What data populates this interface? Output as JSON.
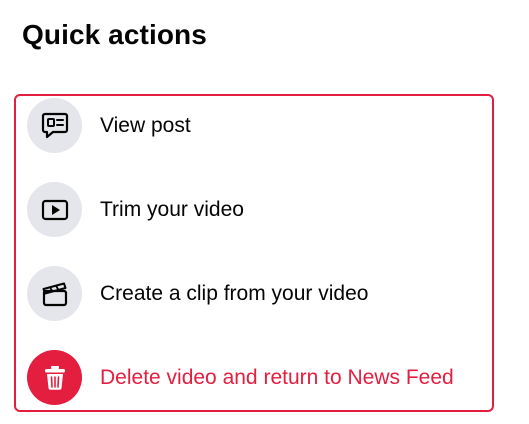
{
  "title": "Quick actions",
  "actions": [
    {
      "label": "View post",
      "icon": "speech-bubble-post-icon"
    },
    {
      "label": "Trim your video",
      "icon": "play-icon"
    },
    {
      "label": "Create a clip from your video",
      "icon": "clapperboard-icon"
    },
    {
      "label": "Delete video and return to News Feed",
      "icon": "trash-icon"
    }
  ],
  "colors": {
    "danger": "#e41e3f",
    "icon_bg": "#e4e6eb",
    "text": "#050505"
  }
}
